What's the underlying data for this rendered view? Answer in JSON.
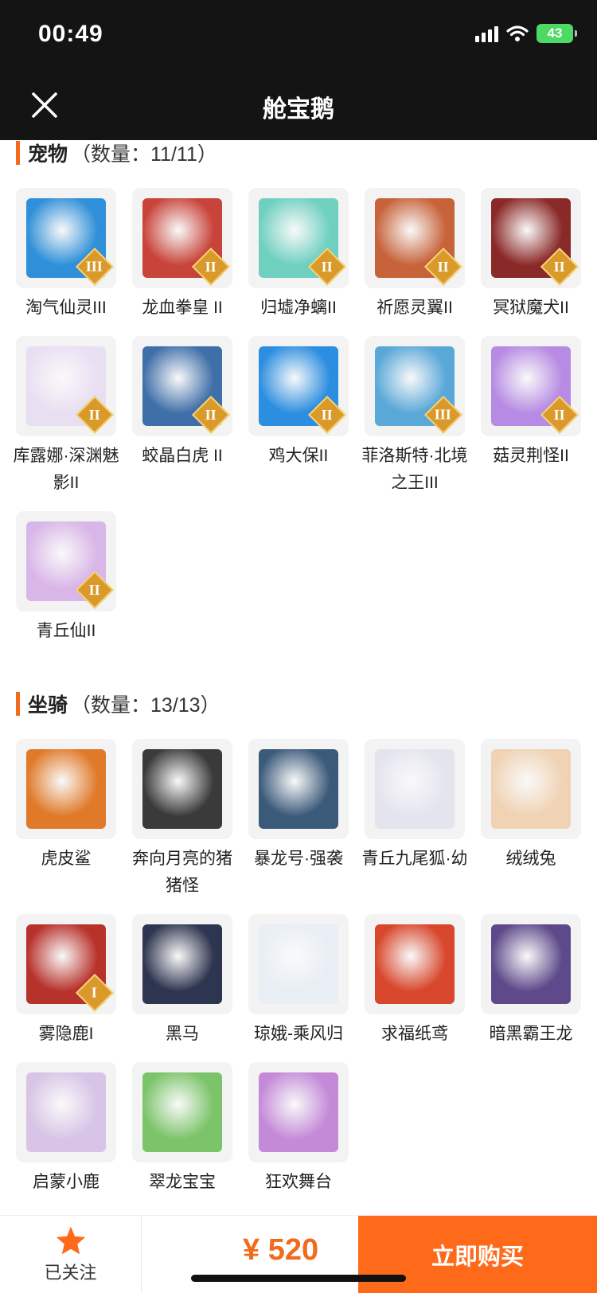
{
  "status_bar": {
    "time": "00:49",
    "battery": "43"
  },
  "nav": {
    "title": "舱宝鹅"
  },
  "sections": [
    {
      "title": "宠物",
      "count": "（数量：11/11）",
      "items": [
        {
          "name": "淘气仙灵III",
          "tier": "III",
          "color": "#2f8fd8",
          "icon": "puppy-icon"
        },
        {
          "name": "龙血拳皇 II",
          "tier": "II",
          "color": "#c8443a",
          "icon": "fire-icon"
        },
        {
          "name": "归墟净螭II",
          "tier": "II",
          "color": "#6fd0c0",
          "icon": "dragon-icon"
        },
        {
          "name": "祈愿灵翼II",
          "tier": "II",
          "color": "#c7633a",
          "icon": "bird-icon"
        },
        {
          "name": "冥狱魔犬II",
          "tier": "II",
          "color": "#8a2a28",
          "icon": "wolf-icon"
        },
        {
          "name": "库露娜·深渊魅影II",
          "tier": "II",
          "color": "#e9dff2",
          "icon": "lady-icon"
        },
        {
          "name": "蛟晶白虎 II",
          "tier": "II",
          "color": "#3f6fa8",
          "icon": "tiger-icon"
        },
        {
          "name": "鸡大保II",
          "tier": "II",
          "color": "#2c8ee0",
          "icon": "chicken-icon"
        },
        {
          "name": "菲洛斯特·北境之王III",
          "tier": "III",
          "color": "#5aa8d8",
          "icon": "ice-king-icon"
        },
        {
          "name": "菇灵荆怪II",
          "tier": "II",
          "color": "#b78be3",
          "icon": "mushroom-icon"
        },
        {
          "name": "青丘仙II",
          "tier": "II",
          "color": "#d9b6e8",
          "icon": "fox-lady-icon"
        }
      ]
    },
    {
      "title": "坐骑",
      "count": "（数量：13/13）",
      "items": [
        {
          "name": "虎皮鲨",
          "tier": "",
          "color": "#e07a2a",
          "icon": "shark-icon"
        },
        {
          "name": "奔向月亮的猪猪怪",
          "tier": "",
          "color": "#3a3a3a",
          "icon": "pig-icon"
        },
        {
          "name": "暴龙号·强袭",
          "tier": "",
          "color": "#3b5a7a",
          "icon": "mech-icon"
        },
        {
          "name": "青丘九尾狐·幼",
          "tier": "",
          "color": "#e4e4ef",
          "icon": "fox-icon"
        },
        {
          "name": "绒绒兔",
          "tier": "",
          "color": "#f0d3b5",
          "icon": "rabbit-icon"
        },
        {
          "name": "雾隐鹿I",
          "tier": "I",
          "color": "#b8322c",
          "icon": "deer-icon"
        },
        {
          "name": "黑马",
          "tier": "",
          "color": "#2e3550",
          "icon": "horse-icon"
        },
        {
          "name": "琼娥-乘风归",
          "tier": "",
          "color": "#e8eef4",
          "icon": "fairy-icon"
        },
        {
          "name": "求福纸鸢",
          "tier": "",
          "color": "#d8472c",
          "icon": "kite-icon"
        },
        {
          "name": "暗黑霸王龙",
          "tier": "",
          "color": "#5e4a8a",
          "icon": "trex-icon"
        },
        {
          "name": "启蒙小鹿",
          "tier": "",
          "color": "#d7c4e6",
          "icon": "fawn-icon"
        },
        {
          "name": "翠龙宝宝",
          "tier": "",
          "color": "#7cc46a",
          "icon": "baby-dragon-icon"
        },
        {
          "name": "狂欢舞台",
          "tier": "",
          "color": "#c48ad8",
          "icon": "stage-icon"
        }
      ]
    }
  ],
  "bottom_bar": {
    "follow_label": "已关注",
    "price": "¥ 520",
    "buy_label": "立即购买"
  },
  "colors": {
    "accent": "#ff6a1a",
    "header_bg": "#141414",
    "tier_badge": "#d99a2b"
  }
}
